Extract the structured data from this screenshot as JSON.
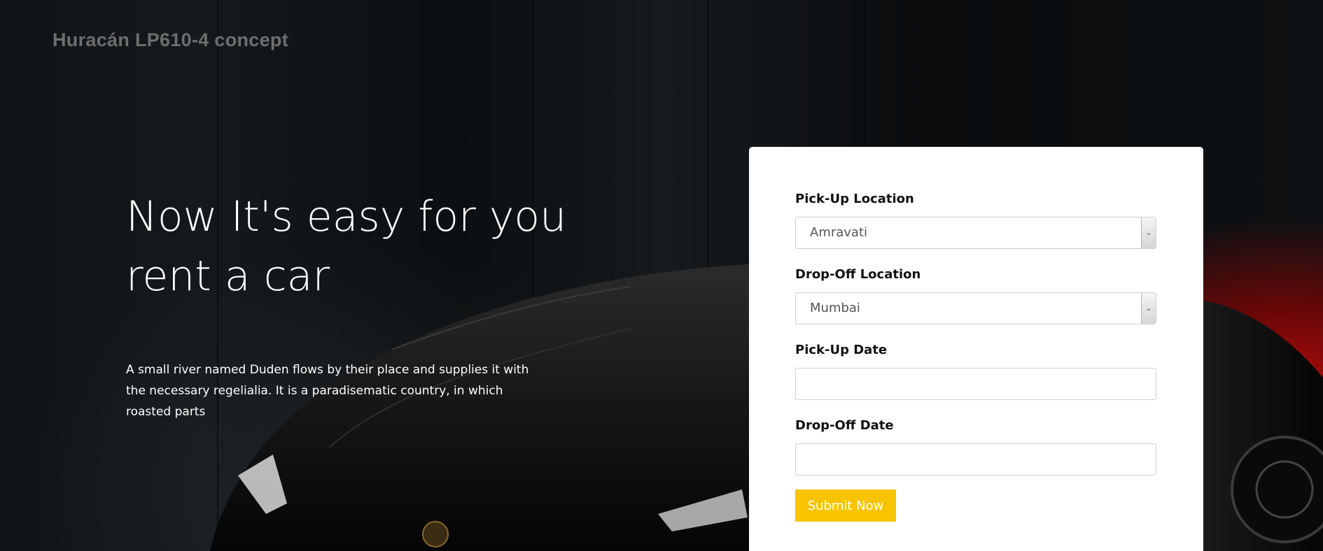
{
  "brand": {
    "title": "Huracán LP610-4 concept"
  },
  "hero": {
    "headline": "Now It's easy for you rent a car",
    "description": "A small river named Duden flows by their place and supplies it with the necessary regelialia. It is a paradisematic country, in which roasted parts"
  },
  "form": {
    "pickup_location": {
      "label": "Pick-Up Location",
      "selected": "Amravati"
    },
    "dropoff_location": {
      "label": "Drop-Off Location",
      "selected": "Mumbai"
    },
    "pickup_date": {
      "label": "Pick-Up Date",
      "value": ""
    },
    "dropoff_date": {
      "label": "Drop-Off Date",
      "value": ""
    },
    "submit_label": "Submit Now"
  },
  "colors": {
    "accent": "#f8c400",
    "card_background": "#ffffff",
    "hero_background": "#0e1113",
    "car_glow": "#b30c0c"
  },
  "icons": {
    "select_arrow": "chevron-down-icon"
  }
}
